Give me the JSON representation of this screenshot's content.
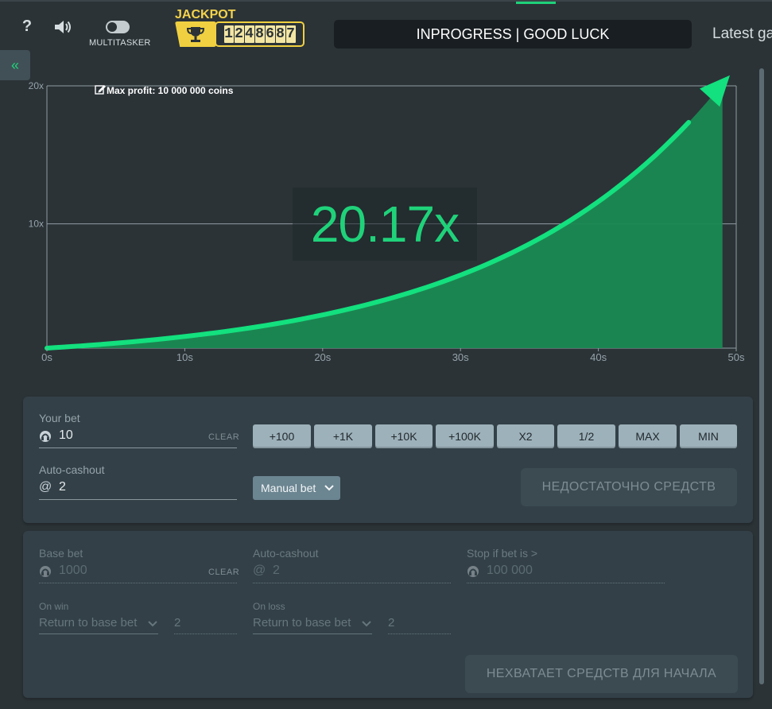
{
  "header": {
    "help_label": "?",
    "multitasker_label": "MULTITASKER",
    "jackpot_label": "JACKPOT",
    "jackpot_digits": [
      "1",
      "2",
      "4",
      "8",
      "6",
      "8",
      "7"
    ],
    "status_text": "INPROGRESS | GOOD LUCK",
    "latest_label": "Latest ga",
    "sidebar_toggle_label": "«"
  },
  "chart_data": {
    "type": "area",
    "title": "",
    "max_profit_label": "Max profit: 10 000 000 coins",
    "xlabel": "",
    "ylabel": "",
    "x_ticks": [
      "0s",
      "10s",
      "20s",
      "30s",
      "40s",
      "50s"
    ],
    "y_ticks": [
      "10x",
      "20x"
    ],
    "xlim": [
      0,
      50
    ],
    "ylim": [
      1,
      20
    ],
    "current_time_s": 49,
    "current_multiplier": 20.17,
    "multiplier_label": "20.17x",
    "curve_color": "#13e07e",
    "fill_color": "#1a8a52"
  },
  "controls": {
    "your_bet_label": "Your bet",
    "your_bet_value": "10",
    "clear_label": "CLEAR",
    "quick_buttons": [
      "+100",
      "+1K",
      "+10K",
      "+100K",
      "X2",
      "1/2",
      "MAX",
      "MIN"
    ],
    "auto_cashout_label": "Auto-cashout",
    "at_symbol": "@",
    "auto_cashout_value": "2",
    "mode_select": "Manual bet",
    "submit_label": "НЕДОСТАТОЧНО СРЕДСТВ"
  },
  "auto": {
    "base_bet_label": "Base bet",
    "base_bet_value": "1000",
    "clear_label": "CLEAR",
    "auto_cashout_label": "Auto-cashout",
    "at_symbol": "@",
    "auto_cashout_value": "2",
    "stop_label": "Stop if bet is >",
    "stop_value": "100 000",
    "on_win_label": "On win",
    "on_win_select": "Return to base bet",
    "on_win_value": "2",
    "on_loss_label": "On loss",
    "on_loss_select": "Return to base bet",
    "on_loss_value": "2",
    "start_label": "НЕХВАТАЕТ СРЕДСТВ ДЛЯ НАЧАЛА"
  },
  "colors": {
    "accent_green": "#1fd27a",
    "jackpot_yellow": "#f0d040"
  }
}
